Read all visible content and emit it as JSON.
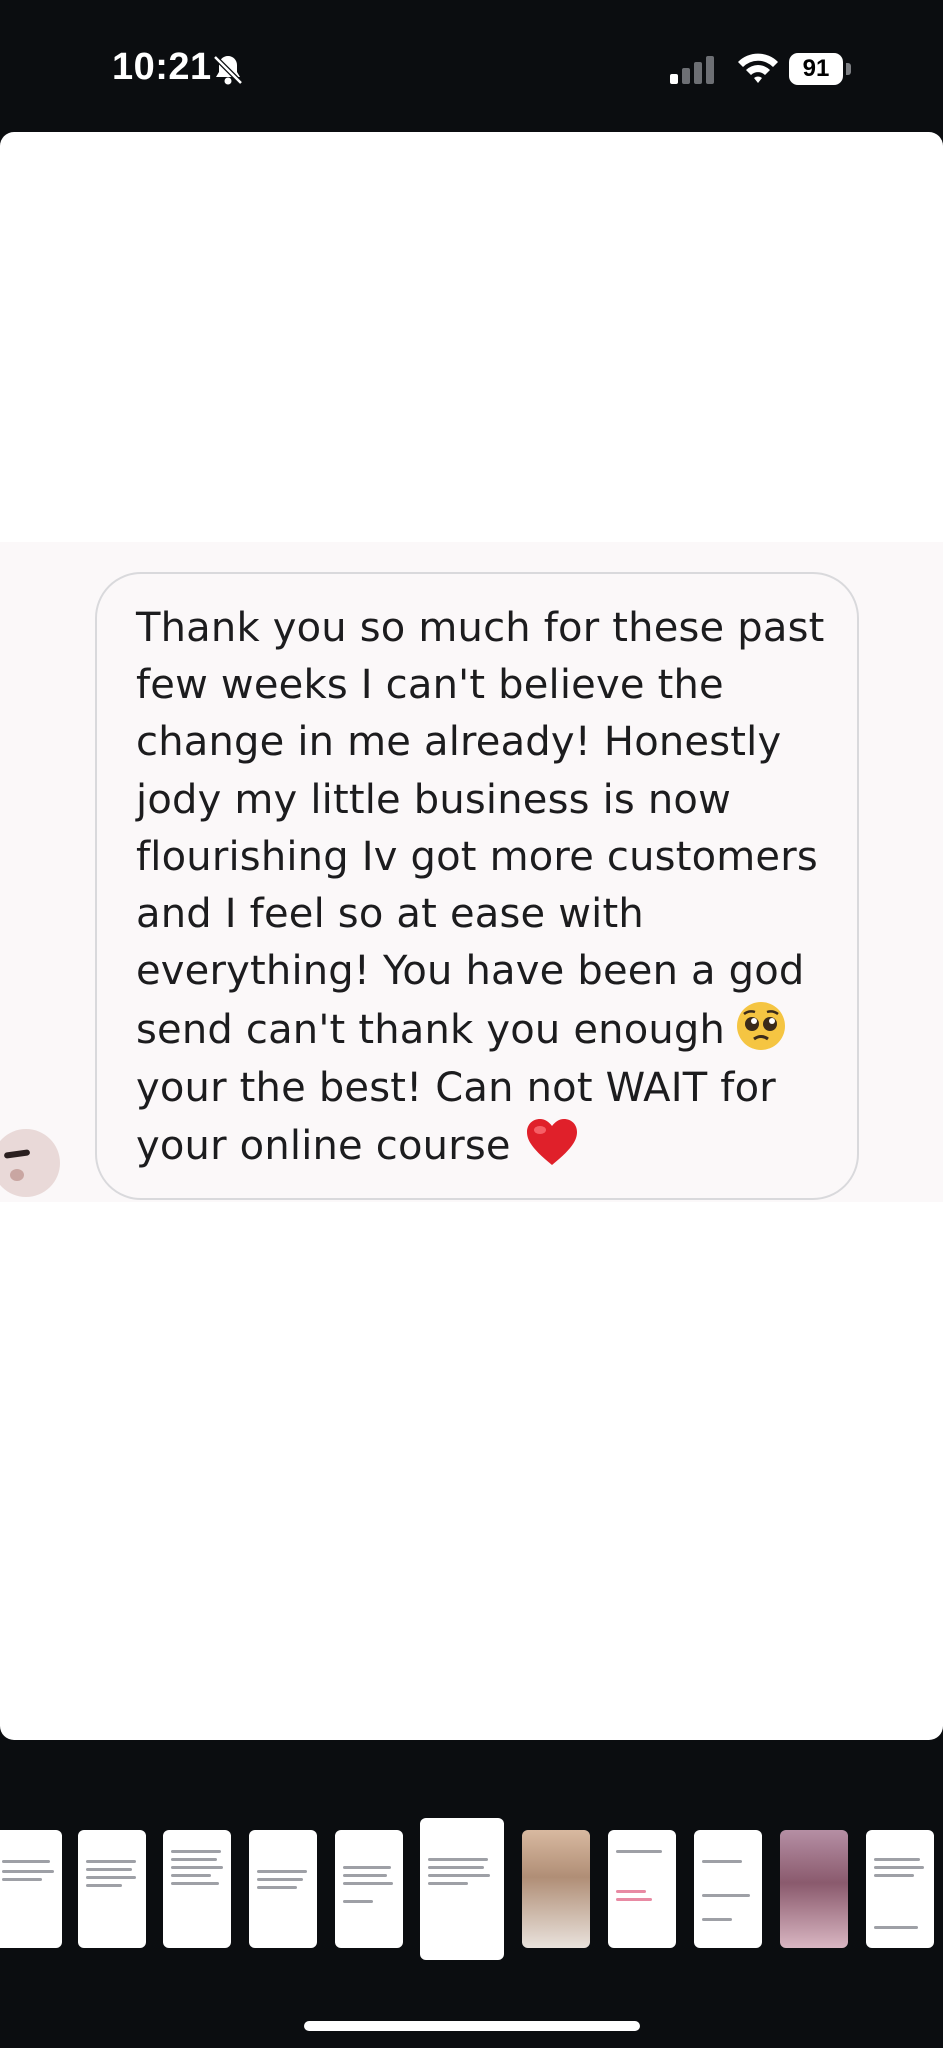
{
  "status_bar": {
    "time": "10:21",
    "battery": "91",
    "icons": [
      "bell-off-icon",
      "cellular-signal-icon",
      "wifi-icon",
      "battery-icon"
    ]
  },
  "story": {
    "message_lines": [
      "Thank you so much for these past",
      "few weeks I can't believe the",
      "change in me already! Honestly",
      "jody my little business is now",
      "flourishing Iv got more customers",
      "and I feel so at ease with",
      "everything! You have been a god",
      "send can't thank you enough",
      "your the best! Can not WAIT for",
      "your online course"
    ],
    "emojis": [
      "pleading-face-emoji",
      "red-heart-emoji"
    ]
  },
  "thumbnails": {
    "count": 11,
    "active_index": 5
  },
  "colors": {
    "background": "#0b0d10",
    "card": "#ffffff",
    "bubble_border": "#d9d9dc",
    "text": "#1c1c1e"
  }
}
